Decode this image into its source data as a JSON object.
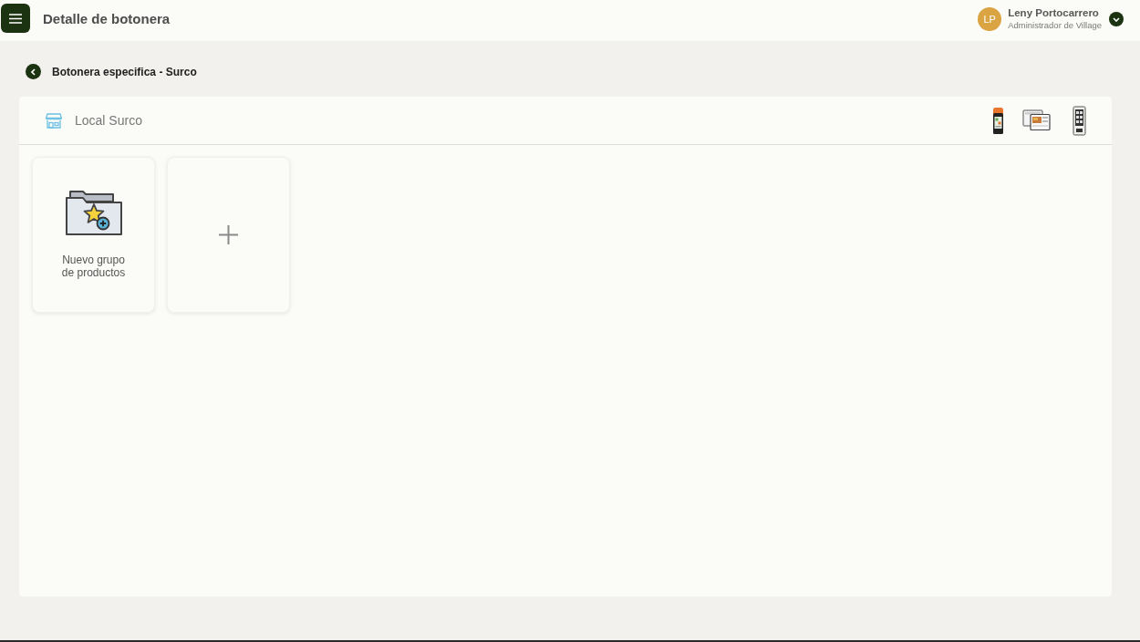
{
  "header": {
    "title": "Detalle de botonera",
    "user": {
      "initials": "LP",
      "name": "Leny Portocarrero",
      "role": "Administrador de Village"
    }
  },
  "breadcrumb": {
    "title": "Botonera especifica - Surco"
  },
  "panel": {
    "store": "Local Surco",
    "devices": [
      {
        "kind": "pos"
      },
      {
        "kind": "tablet"
      },
      {
        "kind": "kiosk"
      }
    ],
    "cards": [
      {
        "kind": "group",
        "label": "Nuevo grupo de productos"
      },
      {
        "kind": "add"
      }
    ]
  }
}
